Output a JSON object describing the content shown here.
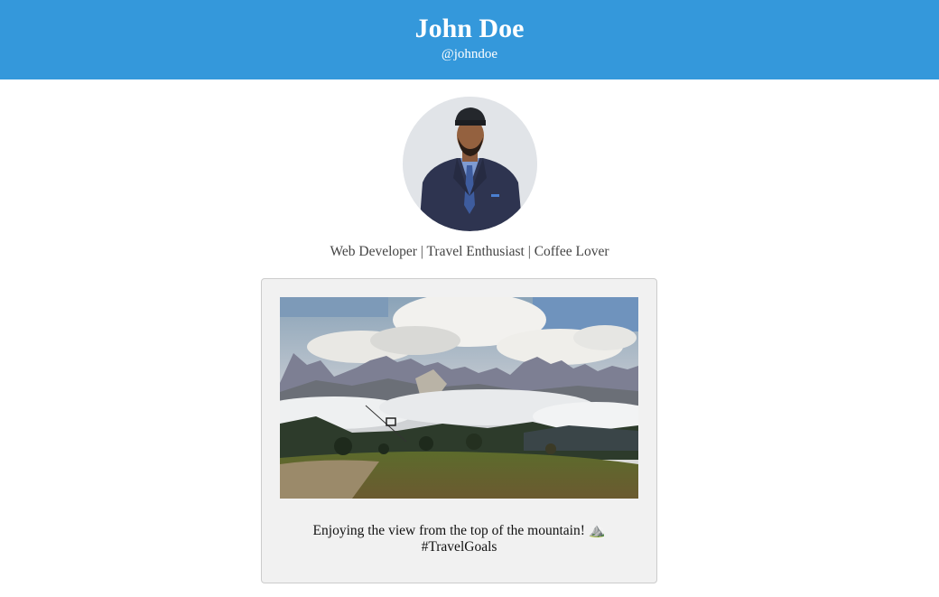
{
  "header": {
    "name": "John Doe",
    "handle": "@johndoe",
    "background_color": "#3498db"
  },
  "profile": {
    "avatar_alt": "profile photo",
    "bio": "Web Developer | Travel Enthusiast | Coffee Lover"
  },
  "post": {
    "image_alt": "mountain landscape with clouds and chairlift",
    "caption_text": "Enjoying the view from the top of the mountain!",
    "caption_emoji": "⛰️",
    "caption_tag": "#TravelGoals"
  }
}
